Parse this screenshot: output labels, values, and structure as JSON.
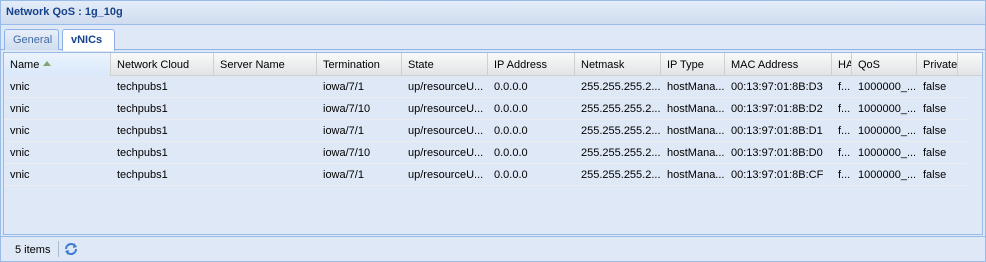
{
  "window": {
    "title": "Network QoS : 1g_10g"
  },
  "tabs": [
    {
      "label": "General"
    },
    {
      "label": "vNICs"
    }
  ],
  "columns": [
    "Name",
    "Network Cloud",
    "Server Name",
    "Termination",
    "State",
    "IP Address",
    "Netmask",
    "IP Type",
    "MAC Address",
    "HA",
    "QoS",
    "Private"
  ],
  "rows": [
    [
      "vnic",
      "techpubs1",
      "",
      "iowa/7/1",
      "up/resourceU...",
      "0.0.0.0",
      "255.255.255.2...",
      "hostMana...",
      "00:13:97:01:8B:D3",
      "f...",
      "1000000_...",
      "false"
    ],
    [
      "vnic",
      "techpubs1",
      "",
      "iowa/7/10",
      "up/resourceU...",
      "0.0.0.0",
      "255.255.255.2...",
      "hostMana...",
      "00:13:97:01:8B:D2",
      "f...",
      "1000000_...",
      "false"
    ],
    [
      "vnic",
      "techpubs1",
      "",
      "iowa/7/1",
      "up/resourceU...",
      "0.0.0.0",
      "255.255.255.2...",
      "hostMana...",
      "00:13:97:01:8B:D1",
      "f...",
      "1000000_...",
      "false"
    ],
    [
      "vnic",
      "techpubs1",
      "",
      "iowa/7/10",
      "up/resourceU...",
      "0.0.0.0",
      "255.255.255.2...",
      "hostMana...",
      "00:13:97:01:8B:D0",
      "f...",
      "1000000_...",
      "false"
    ],
    [
      "vnic",
      "techpubs1",
      "",
      "iowa/7/1",
      "up/resourceU...",
      "0.0.0.0",
      "255.255.255.2...",
      "hostMana...",
      "00:13:97:01:8B:CF",
      "f...",
      "1000000_...",
      "false"
    ]
  ],
  "footer": {
    "count": "5 items",
    "refresh_icon": "refresh-icon"
  },
  "colors": {
    "title": "#15428b",
    "panel_bg": "#dfe8f6",
    "border": "#99bbe8"
  }
}
